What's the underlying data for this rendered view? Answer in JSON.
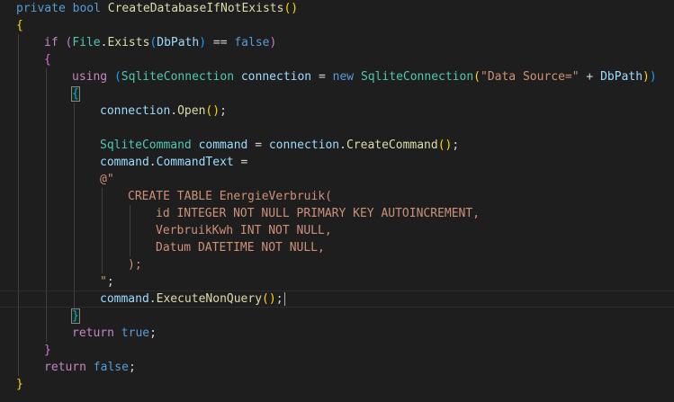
{
  "colors": {
    "background": "#1e1e1e",
    "keyword": "#569cd6",
    "control": "#c586c0",
    "type": "#4ec9b0",
    "method": "#dcdcaa",
    "variable": "#9cdcfe",
    "string": "#ce9178",
    "plain": "#d4d4d4",
    "bracket1": "#ffd700",
    "bracket2": "#da70d6",
    "bracket3": "#179fff"
  },
  "lines": [
    {
      "indent": 0,
      "tokens": [
        [
          "kw",
          "private"
        ],
        [
          "pl",
          " "
        ],
        [
          "kw",
          "bool"
        ],
        [
          "pl",
          " "
        ],
        [
          "fn",
          "CreateDatabaseIfNotExists"
        ],
        [
          "b1",
          "()"
        ]
      ]
    },
    {
      "indent": 0,
      "tokens": [
        [
          "b1",
          "{"
        ]
      ]
    },
    {
      "indent": 1,
      "tokens": [
        [
          "ctl",
          "if"
        ],
        [
          "pl",
          " "
        ],
        [
          "b2",
          "("
        ],
        [
          "typ",
          "File"
        ],
        [
          "pl",
          "."
        ],
        [
          "fn",
          "Exists"
        ],
        [
          "b3",
          "("
        ],
        [
          "var",
          "DbPath"
        ],
        [
          "b3",
          ")"
        ],
        [
          "pl",
          " == "
        ],
        [
          "kw",
          "false"
        ],
        [
          "b2",
          ")"
        ]
      ]
    },
    {
      "indent": 1,
      "tokens": [
        [
          "b2",
          "{"
        ]
      ]
    },
    {
      "indent": 2,
      "tokens": [
        [
          "ctl",
          "using"
        ],
        [
          "pl",
          " "
        ],
        [
          "b3",
          "("
        ],
        [
          "typ",
          "SqliteConnection"
        ],
        [
          "pl",
          " "
        ],
        [
          "var",
          "connection"
        ],
        [
          "pl",
          " = "
        ],
        [
          "kw",
          "new"
        ],
        [
          "pl",
          " "
        ],
        [
          "typ",
          "SqliteConnection"
        ],
        [
          "b1",
          "("
        ],
        [
          "str",
          "\"Data Source=\""
        ],
        [
          "pl",
          " + "
        ],
        [
          "var",
          "DbPath"
        ],
        [
          "b1",
          ")"
        ],
        [
          "b3",
          ")"
        ]
      ]
    },
    {
      "indent": 2,
      "tokens": [
        [
          "b3hl",
          "{"
        ]
      ]
    },
    {
      "indent": 3,
      "tokens": [
        [
          "var",
          "connection"
        ],
        [
          "pl",
          "."
        ],
        [
          "fn",
          "Open"
        ],
        [
          "b1",
          "()"
        ],
        [
          "pl",
          ";"
        ]
      ]
    },
    {
      "indent": 3,
      "tokens": []
    },
    {
      "indent": 3,
      "tokens": [
        [
          "typ",
          "SqliteCommand"
        ],
        [
          "pl",
          " "
        ],
        [
          "var",
          "command"
        ],
        [
          "pl",
          " = "
        ],
        [
          "var",
          "connection"
        ],
        [
          "pl",
          "."
        ],
        [
          "fn",
          "CreateCommand"
        ],
        [
          "b1",
          "()"
        ],
        [
          "pl",
          ";"
        ]
      ]
    },
    {
      "indent": 3,
      "tokens": [
        [
          "var",
          "command"
        ],
        [
          "pl",
          "."
        ],
        [
          "var",
          "CommandText"
        ],
        [
          "pl",
          " ="
        ]
      ]
    },
    {
      "indent": 3,
      "tokens": [
        [
          "str",
          "@\""
        ]
      ]
    },
    {
      "indent": 4,
      "tokens": [
        [
          "str",
          "CREATE TABLE EnergieVerbruik("
        ]
      ]
    },
    {
      "indent": 5,
      "tokens": [
        [
          "str",
          "id INTEGER NOT NULL PRIMARY KEY AUTOINCREMENT,"
        ]
      ]
    },
    {
      "indent": 5,
      "tokens": [
        [
          "str",
          "VerbruikKwh INT NOT NULL,"
        ]
      ]
    },
    {
      "indent": 5,
      "tokens": [
        [
          "str",
          "Datum DATETIME NOT NULL,"
        ]
      ]
    },
    {
      "indent": 4,
      "tokens": [
        [
          "str",
          ");"
        ]
      ]
    },
    {
      "indent": 3,
      "tokens": [
        [
          "str",
          "\""
        ],
        [
          "pl",
          ";"
        ]
      ]
    },
    {
      "indent": 3,
      "tokens": [
        [
          "var",
          "command"
        ],
        [
          "pl",
          "."
        ],
        [
          "fn",
          "ExecuteNonQuery"
        ],
        [
          "b1",
          "()"
        ],
        [
          "pl",
          ";"
        ]
      ],
      "current": true
    },
    {
      "indent": 2,
      "tokens": [
        [
          "b3hl",
          "}"
        ]
      ]
    },
    {
      "indent": 2,
      "tokens": [
        [
          "ctl",
          "return"
        ],
        [
          "pl",
          " "
        ],
        [
          "kw",
          "true"
        ],
        [
          "pl",
          ";"
        ]
      ]
    },
    {
      "indent": 1,
      "tokens": [
        [
          "b2",
          "}"
        ]
      ]
    },
    {
      "indent": 1,
      "tokens": [
        [
          "ctl",
          "return"
        ],
        [
          "pl",
          " "
        ],
        [
          "kw",
          "false"
        ],
        [
          "pl",
          ";"
        ]
      ]
    },
    {
      "indent": 0,
      "tokens": [
        [
          "b1",
          "}"
        ]
      ]
    }
  ]
}
